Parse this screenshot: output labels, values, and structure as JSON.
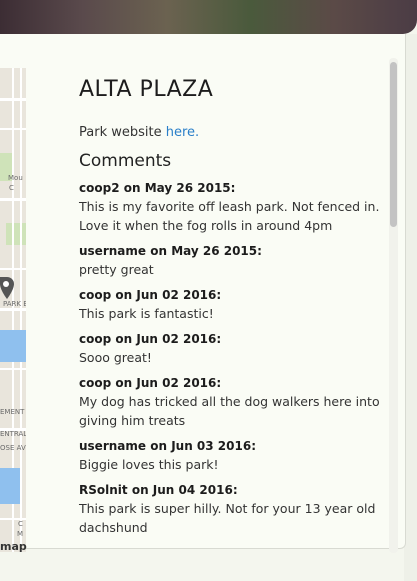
{
  "park": {
    "name": "ALTA PLAZA",
    "website_prefix": "Park website ",
    "website_link": "here."
  },
  "comments_heading": "Comments",
  "comments": [
    {
      "author": "coop2",
      "date": "May 26 2015",
      "text": "This is my favorite off leash park. Not fenced in. Love it when the fog rolls in around 4pm"
    },
    {
      "author": "username",
      "date": "May 26 2015",
      "text": "pretty great"
    },
    {
      "author": "coop",
      "date": "Jun 02 2016",
      "text": "This park is fantastic!"
    },
    {
      "author": "coop",
      "date": "Jun 02 2016",
      "text": "Sooo great!"
    },
    {
      "author": "coop",
      "date": "Jun 02 2016",
      "text": "My dog has tricked all the dog walkers here into giving him treats"
    },
    {
      "author": "username",
      "date": "Jun 03 2016",
      "text": "Biggie loves this park!"
    },
    {
      "author": "RSolnit",
      "date": "Jun 04 2016",
      "text": "This park is super hilly. Not for your 13 year old dachshund"
    }
  ],
  "map": {
    "labels": [
      "Mou",
      "C",
      "PARK B",
      "EMENT",
      "ENTRAL A",
      "OSE AVE",
      "C",
      "M"
    ],
    "caption": "map",
    "pin_icon": "dog-icon"
  },
  "colors": {
    "link": "#2a7fc9",
    "water": "#8fc0ee",
    "park": "#cfe3b9"
  }
}
